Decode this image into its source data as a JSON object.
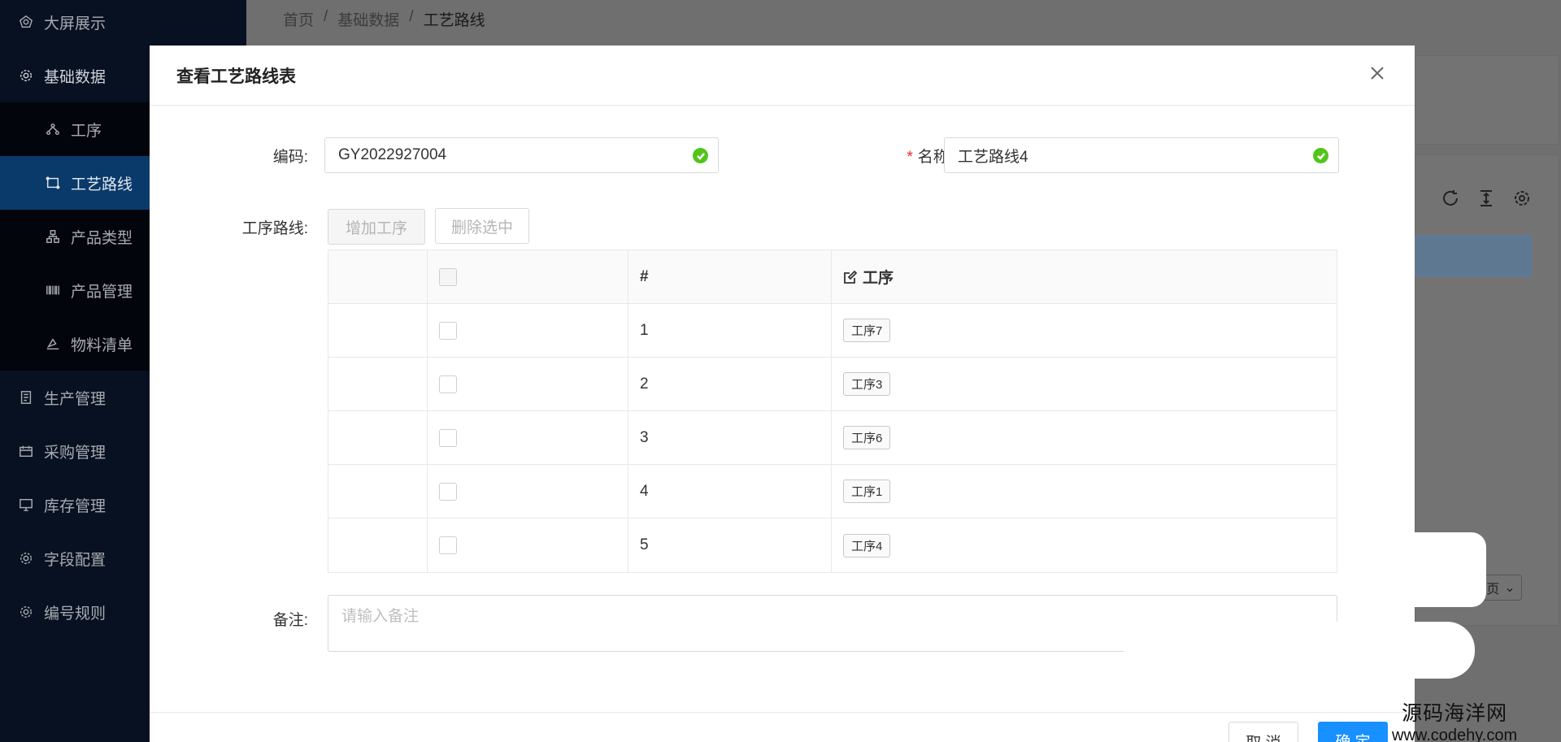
{
  "sidebar": {
    "items": [
      {
        "label": "大屏展示",
        "icon": "dashboard-icon"
      },
      {
        "label": "基础数据",
        "icon": "gear-icon"
      },
      {
        "label": "工序",
        "icon": "process-node-icon"
      },
      {
        "label": "工艺路线",
        "icon": "route-icon"
      },
      {
        "label": "产品类型",
        "icon": "category-icon"
      },
      {
        "label": "产品管理",
        "icon": "barcode-icon"
      },
      {
        "label": "物料清单",
        "icon": "material-icon"
      },
      {
        "label": "生产管理",
        "icon": "document-icon"
      },
      {
        "label": "采购管理",
        "icon": "purchase-icon"
      },
      {
        "label": "库存管理",
        "icon": "monitor-icon"
      },
      {
        "label": "字段配置",
        "icon": "gear-icon"
      },
      {
        "label": "编号规则",
        "icon": "gear-icon"
      }
    ]
  },
  "breadcrumb": {
    "items": [
      "首页",
      "基础数据",
      "工艺路线"
    ],
    "separator": "/"
  },
  "background": {
    "pager_text": "页"
  },
  "dialog": {
    "title": "查看工艺路线表",
    "code_label": "编码:",
    "code_value": "GY2022927004",
    "name_label": "名称:",
    "name_required": "*",
    "name_value": "工艺路线4",
    "route_label": "工序路线:",
    "add_button": "增加工序",
    "delete_button": "删除选中",
    "table": {
      "headers": {
        "index": "#",
        "process": "工序"
      },
      "rows": [
        {
          "index": "1",
          "process": "工序7"
        },
        {
          "index": "2",
          "process": "工序3"
        },
        {
          "index": "3",
          "process": "工序6"
        },
        {
          "index": "4",
          "process": "工序1"
        },
        {
          "index": "5",
          "process": "工序4"
        }
      ]
    },
    "remark_label": "备注:",
    "remark_placeholder": "请输入备注",
    "cancel_button": "取 消",
    "ok_button": "确 定"
  },
  "watermark": {
    "line1": "源码海洋网",
    "line2": "www.codehy.com"
  },
  "colors": {
    "sidebar_bg": "#071122",
    "sidebar_active": "#0a3a6a",
    "primary": "#1890ff",
    "success": "#52c41a",
    "required": "#f5222d"
  }
}
